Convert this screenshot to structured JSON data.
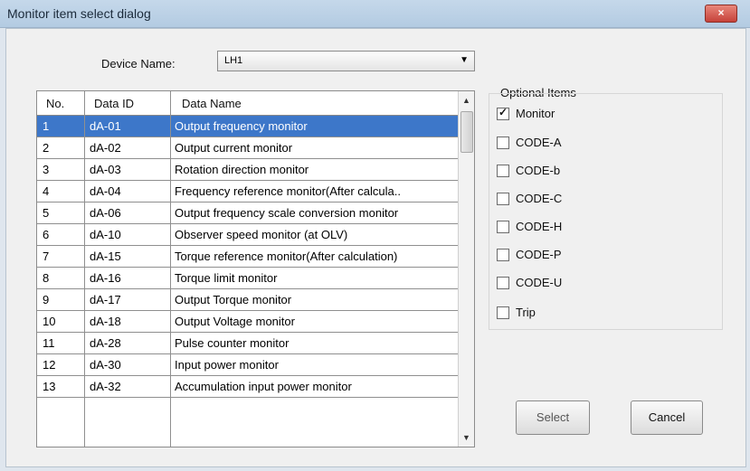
{
  "window": {
    "title": "Monitor item select dialog",
    "close_label": "×"
  },
  "device": {
    "label": "Device Name:",
    "value": "LH1"
  },
  "table": {
    "headers": {
      "no": "No.",
      "data_id": "Data ID",
      "data_name": "Data Name"
    },
    "rows": [
      {
        "no": "1",
        "id": "dA-01",
        "name": "Output frequency monitor"
      },
      {
        "no": "2",
        "id": "dA-02",
        "name": "Output current monitor"
      },
      {
        "no": "3",
        "id": "dA-03",
        "name": "Rotation direction monitor"
      },
      {
        "no": "4",
        "id": "dA-04",
        "name": "Frequency reference monitor(After calcula.."
      },
      {
        "no": "5",
        "id": "dA-06",
        "name": "Output frequency scale conversion monitor"
      },
      {
        "no": "6",
        "id": "dA-10",
        "name": "Observer speed monitor (at OLV)"
      },
      {
        "no": "7",
        "id": "dA-15",
        "name": "Torque reference monitor(After calculation)"
      },
      {
        "no": "8",
        "id": "dA-16",
        "name": "Torque limit monitor"
      },
      {
        "no": "9",
        "id": "dA-17",
        "name": "Output Torque monitor"
      },
      {
        "no": "10",
        "id": "dA-18",
        "name": "Output Voltage monitor"
      },
      {
        "no": "11",
        "id": "dA-28",
        "name": "Pulse counter monitor"
      },
      {
        "no": "12",
        "id": "dA-30",
        "name": "Input power monitor"
      },
      {
        "no": "13",
        "id": "dA-32",
        "name": "Accumulation input power monitor"
      }
    ],
    "selected_row": "1"
  },
  "optional": {
    "title": "Optional Items",
    "items": [
      {
        "label": "Monitor",
        "checked": true
      },
      {
        "label": "CODE-A",
        "checked": false
      },
      {
        "label": "CODE-b",
        "checked": false
      },
      {
        "label": "CODE-C",
        "checked": false
      },
      {
        "label": "CODE-H",
        "checked": false
      },
      {
        "label": "CODE-P",
        "checked": false
      },
      {
        "label": "CODE-U",
        "checked": false
      },
      {
        "label": "Trip",
        "checked": false
      }
    ]
  },
  "buttons": {
    "select": "Select",
    "cancel": "Cancel"
  },
  "colors": {
    "selection": "#3d77c9",
    "close_button": "#c6423a"
  }
}
